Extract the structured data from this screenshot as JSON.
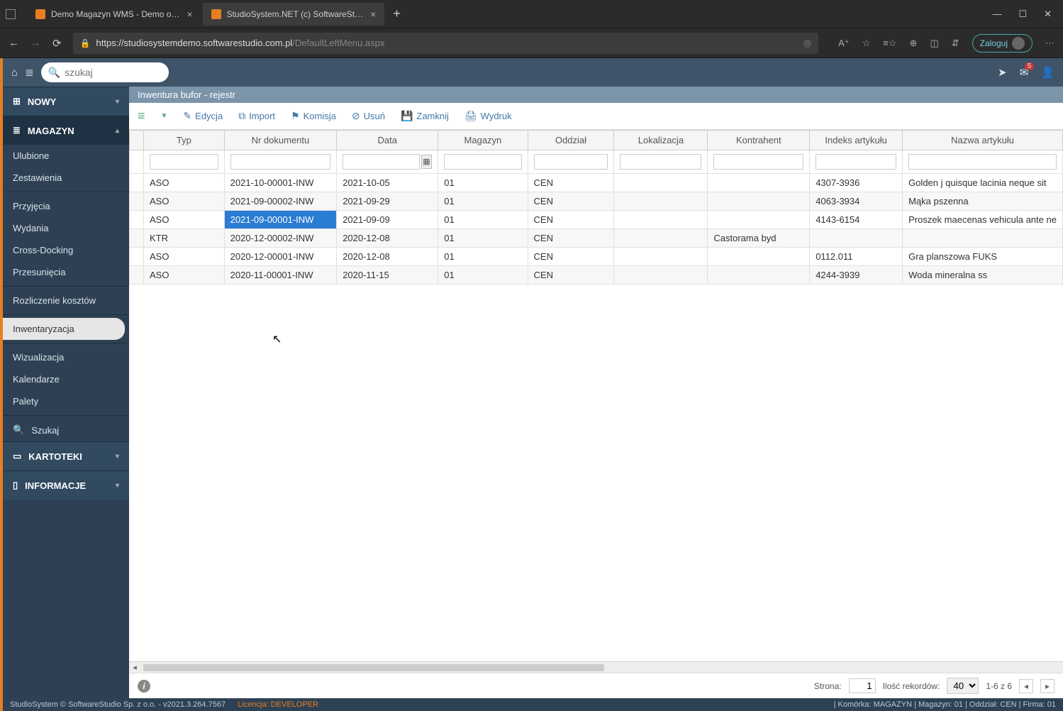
{
  "browser": {
    "tabs": [
      {
        "label": "Demo Magazyn WMS - Demo o…",
        "active": false
      },
      {
        "label": "StudioSystem.NET (c) SoftwareSt…",
        "active": true
      }
    ],
    "url_host": "https://studiosystemdemo.softwarestudio.com.pl",
    "url_path": "/DefaultLeftMenu.aspx",
    "login_label": "Zaloguj"
  },
  "topbar": {
    "search_placeholder": "szukaj",
    "mail_badge": "5"
  },
  "sidebar": {
    "nowy": "NOWY",
    "magazyn": "MAGAZYN",
    "items1": [
      "Ulubione",
      "Zestawienia"
    ],
    "items2": [
      "Przyjęcia",
      "Wydania",
      "Cross-Docking",
      "Przesunięcia"
    ],
    "items3": [
      "Rozliczenie kosztów"
    ],
    "items4": [
      "Inwentaryzacja"
    ],
    "items5": [
      "Wizualizacja",
      "Kalendarze",
      "Palety"
    ],
    "szukaj": "Szukaj",
    "kartoteki": "KARTOTEKI",
    "informacje": "INFORMACJE"
  },
  "content": {
    "crumb": "Inwentura bufor - rejestr",
    "toolbar": {
      "edycja": "Edycja",
      "import": "Import",
      "komisja": "Komisja",
      "usun": "Usuń",
      "zamknij": "Zamknij",
      "wydruk": "Wydruk"
    },
    "columns": [
      "Typ",
      "Nr dokumentu",
      "Data",
      "Magazyn",
      "Oddział",
      "Lokalizacja",
      "Kontrahent",
      "Indeks artykułu",
      "Nazwa artykułu"
    ],
    "rows": [
      {
        "typ": "ASO",
        "nr": "2021-10-00001-INW",
        "data": "2021-10-05",
        "mag": "01",
        "odd": "CEN",
        "lok": "",
        "kon": "",
        "idx": "4307-3936",
        "naz": "Golden j quisque lacinia neque sit"
      },
      {
        "typ": "ASO",
        "nr": "2021-09-00002-INW",
        "data": "2021-09-29",
        "mag": "01",
        "odd": "CEN",
        "lok": "",
        "kon": "",
        "idx": "4063-3934",
        "naz": "Mąka pszenna"
      },
      {
        "typ": "ASO",
        "nr": "2021-09-00001-INW",
        "data": "2021-09-09",
        "mag": "01",
        "odd": "CEN",
        "lok": "",
        "kon": "",
        "idx": "4143-6154",
        "naz": "Proszek maecenas vehicula ante ne"
      },
      {
        "typ": "KTR",
        "nr": "2020-12-00002-INW",
        "data": "2020-12-08",
        "mag": "01",
        "odd": "CEN",
        "lok": "",
        "kon": "Castorama byd",
        "idx": "",
        "naz": ""
      },
      {
        "typ": "ASO",
        "nr": "2020-12-00001-INW",
        "data": "2020-12-08",
        "mag": "01",
        "odd": "CEN",
        "lok": "",
        "kon": "",
        "idx": "0112.011",
        "naz": "Gra planszowa FUKS"
      },
      {
        "typ": "ASO",
        "nr": "2020-11-00001-INW",
        "data": "2020-11-15",
        "mag": "01",
        "odd": "CEN",
        "lok": "",
        "kon": "",
        "idx": "4244-3939",
        "naz": "Woda mineralna ss"
      }
    ],
    "selected_row": 2,
    "pager": {
      "strona_label": "Strona:",
      "strona_val": "1",
      "ilosc_label": "Ilość rekordów:",
      "ilosc_val": "40",
      "range": "1-6 z 6"
    }
  },
  "status": {
    "left": "StudioSystem © SoftwareStudio Sp. z o.o. - v2021.3.264.7567",
    "lic_label": "Licencja: ",
    "lic_val": "DEVELOPER",
    "right": "| Komórka: MAGAZYN | Magazyn: 01 | Oddział: CEN | Firma: 01"
  }
}
